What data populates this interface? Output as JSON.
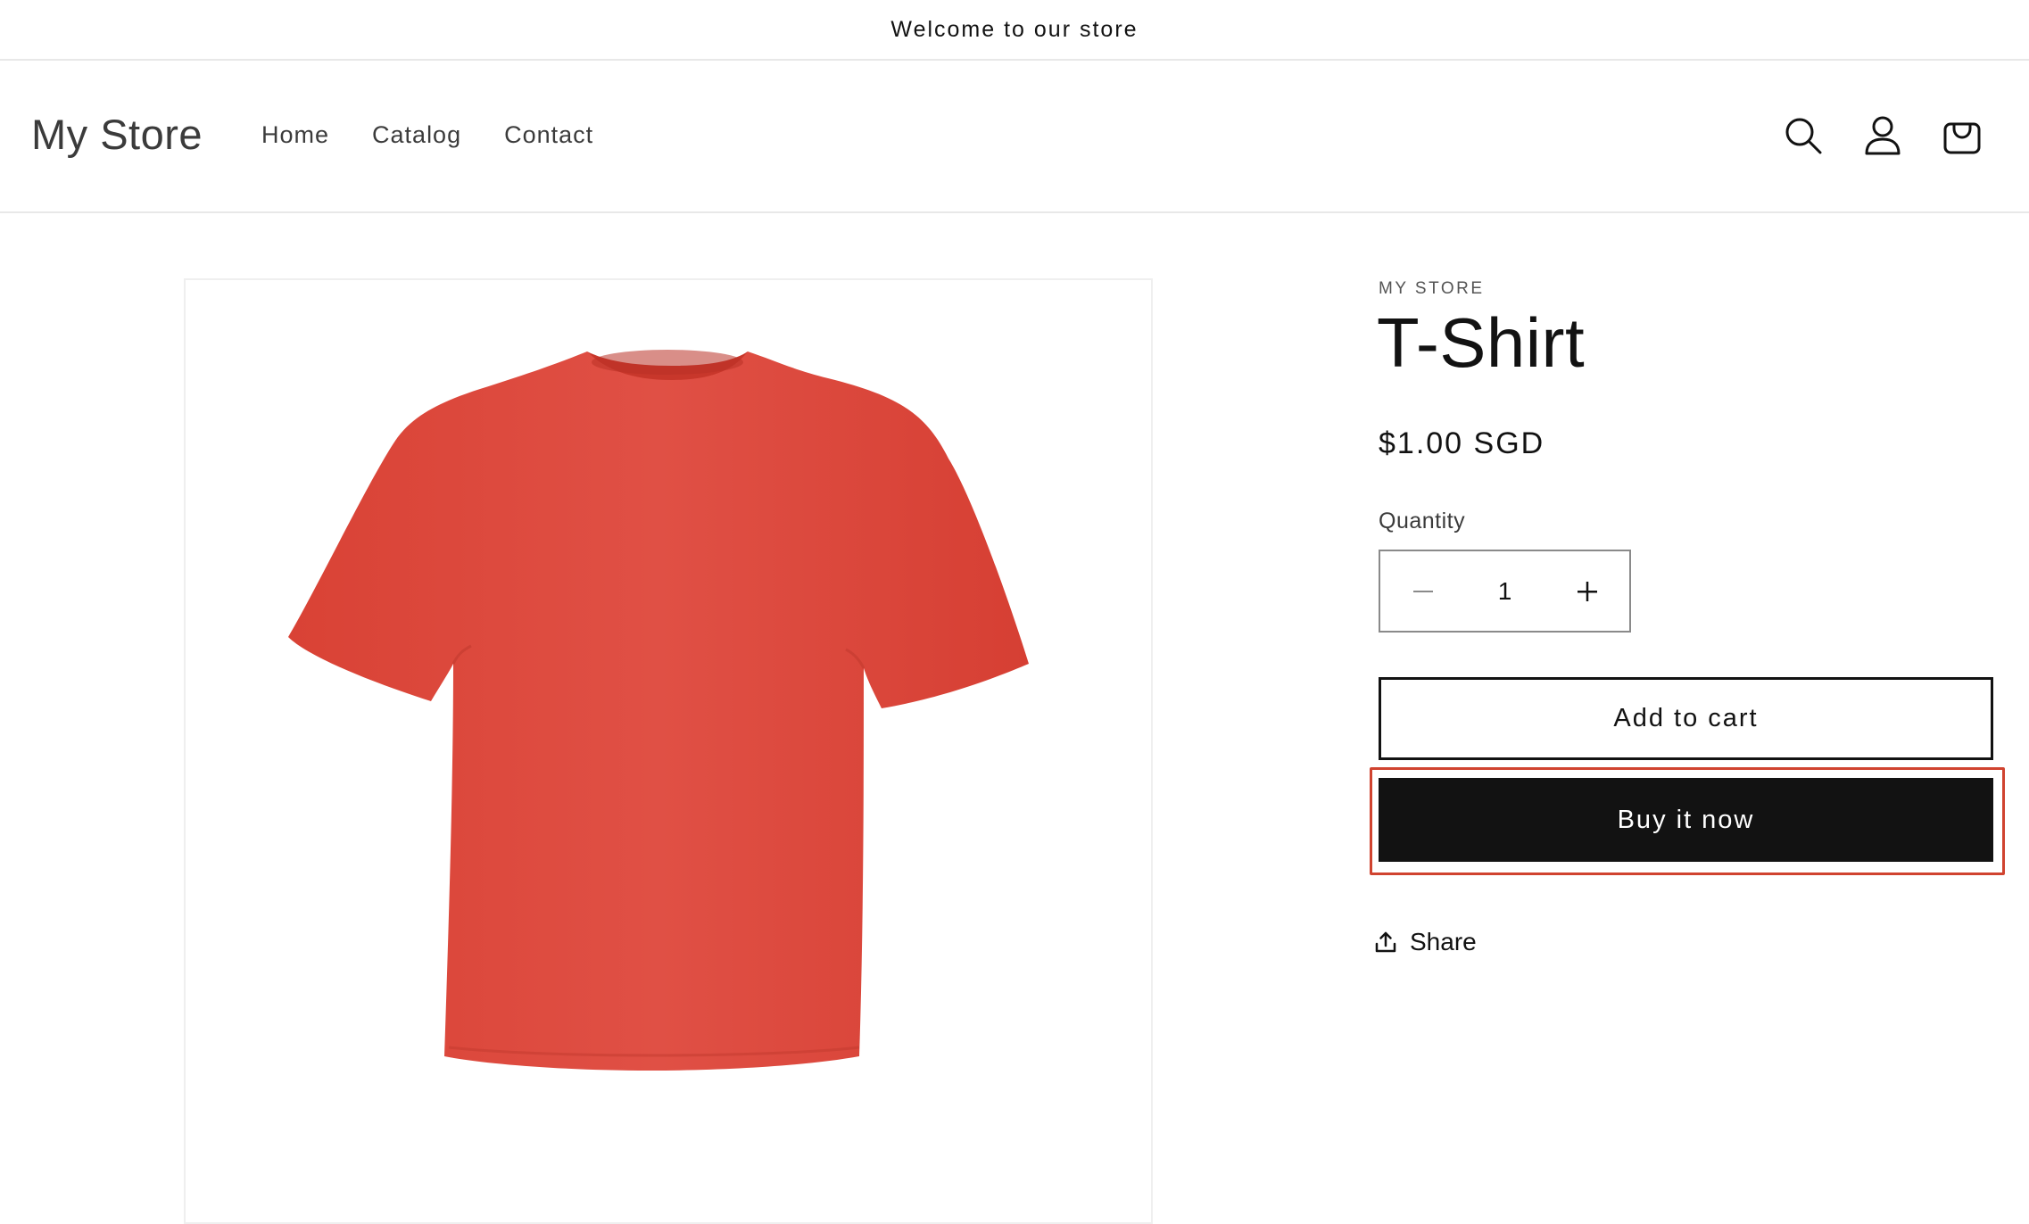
{
  "announcement": {
    "text": "Welcome to our store"
  },
  "header": {
    "logo": "My Store",
    "nav": [
      {
        "label": "Home"
      },
      {
        "label": "Catalog"
      },
      {
        "label": "Contact"
      }
    ],
    "icons": [
      "search-icon",
      "account-icon",
      "cart-icon"
    ]
  },
  "product": {
    "vendor": "MY STORE",
    "title": "T-Shirt",
    "price": "$1.00 SGD",
    "quantity_label": "Quantity",
    "quantity_value": "1",
    "add_to_cart_label": "Add to cart",
    "buy_now_label": "Buy it now",
    "share_label": "Share",
    "image_color": "#de4a3d"
  },
  "colors": {
    "text": "#121212",
    "buy_button_bg": "#121212",
    "highlight": "#d0432f"
  }
}
